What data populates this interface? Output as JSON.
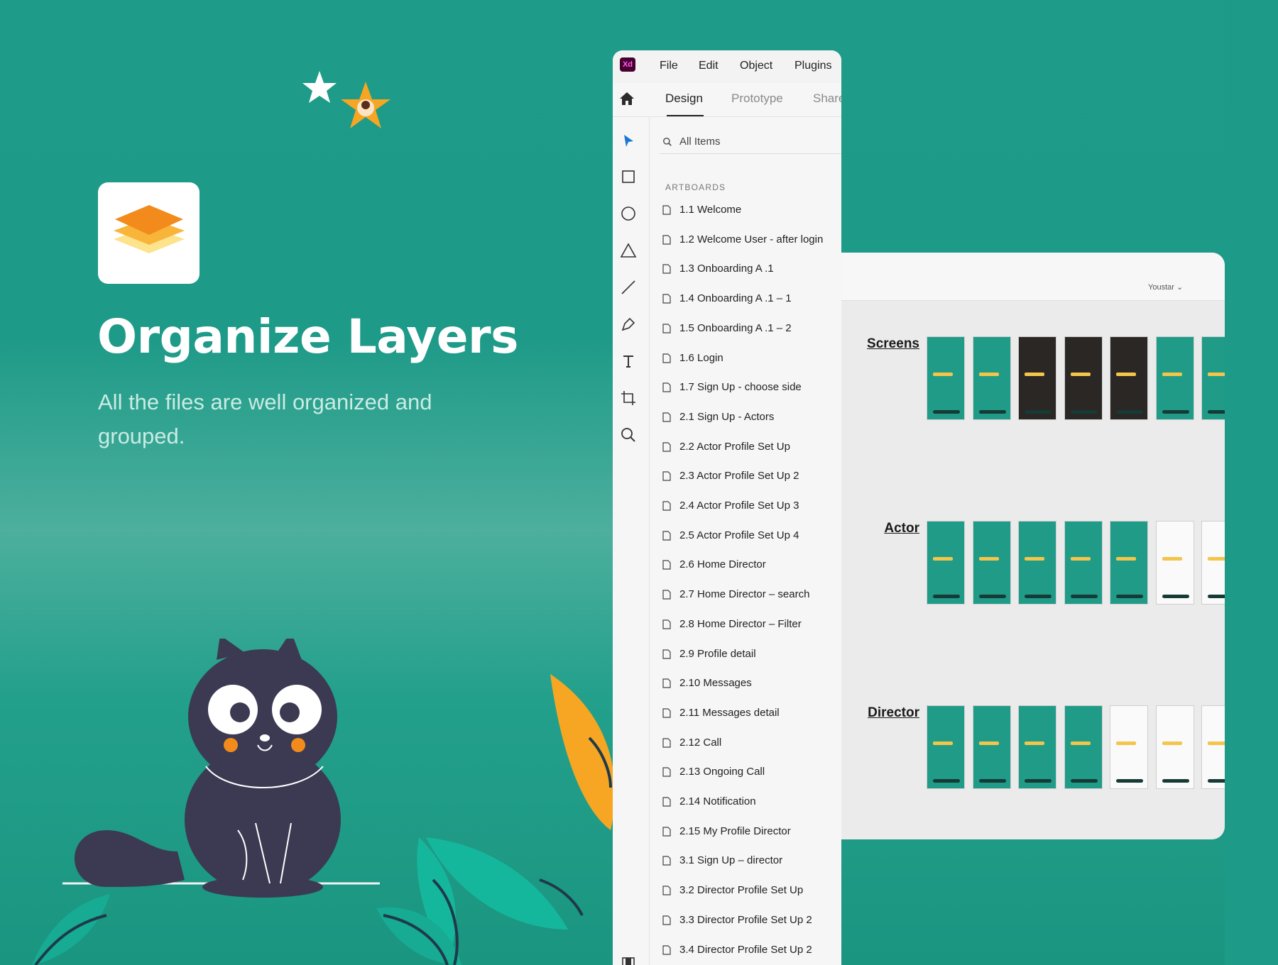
{
  "promo": {
    "title": "Organize Layers",
    "subtitle": "All the files are well organized and grouped."
  },
  "colors": {
    "background": "#1f9b89",
    "accent_orange": "#f28b1c",
    "panel_bg": "#f6f6f6",
    "canvas_bg": "#ebebeb"
  },
  "xd": {
    "logo": "Xd",
    "menu": [
      "File",
      "Edit",
      "Object",
      "Plugins"
    ],
    "tabs": [
      "Design",
      "Prototype",
      "Share"
    ],
    "active_tab": "Design",
    "search_placeholder": "All Items",
    "section_label": "ARTBOARDS",
    "tools": [
      "select-arrow-icon",
      "rectangle-icon",
      "ellipse-icon",
      "polygon-icon",
      "line-icon",
      "pen-icon",
      "text-icon",
      "artboard-icon",
      "zoom-icon",
      "assets-icon",
      "layers-icon"
    ],
    "artboards": [
      "1.1 Welcome",
      "1.2 Welcome User - after login",
      "1.3 Onboarding A .1",
      "1.4 Onboarding A .1 – 1",
      "1.5 Onboarding A .1 – 2",
      "1.6 Login",
      "1.7  Sign Up - choose side",
      "2.1 Sign Up - Actors",
      "2.2 Actor Profile Set Up",
      "2.3 Actor Profile Set Up 2",
      "2.4 Actor Profile Set Up 3",
      "2.5 Actor Profile Set Up 4",
      "2.6 Home Director",
      "2.7 Home Director – search",
      "2.8 Home Director – Filter",
      "2.9 Profile detail",
      "2.10 Messages",
      "2.11 Messages detail",
      "2.12 Call",
      "2.13 Ongoing Call",
      "2.14 Notification",
      "2.15 My Profile Director",
      "3.1 Sign Up – director",
      "3.2 Director Profile Set Up",
      "3.3 Director Profile Set Up 2",
      "3.4 Director Profile Set Up 2"
    ]
  },
  "canvas": {
    "user": "Youstar",
    "groups": [
      "Screens",
      "Actor",
      "Director"
    ]
  }
}
